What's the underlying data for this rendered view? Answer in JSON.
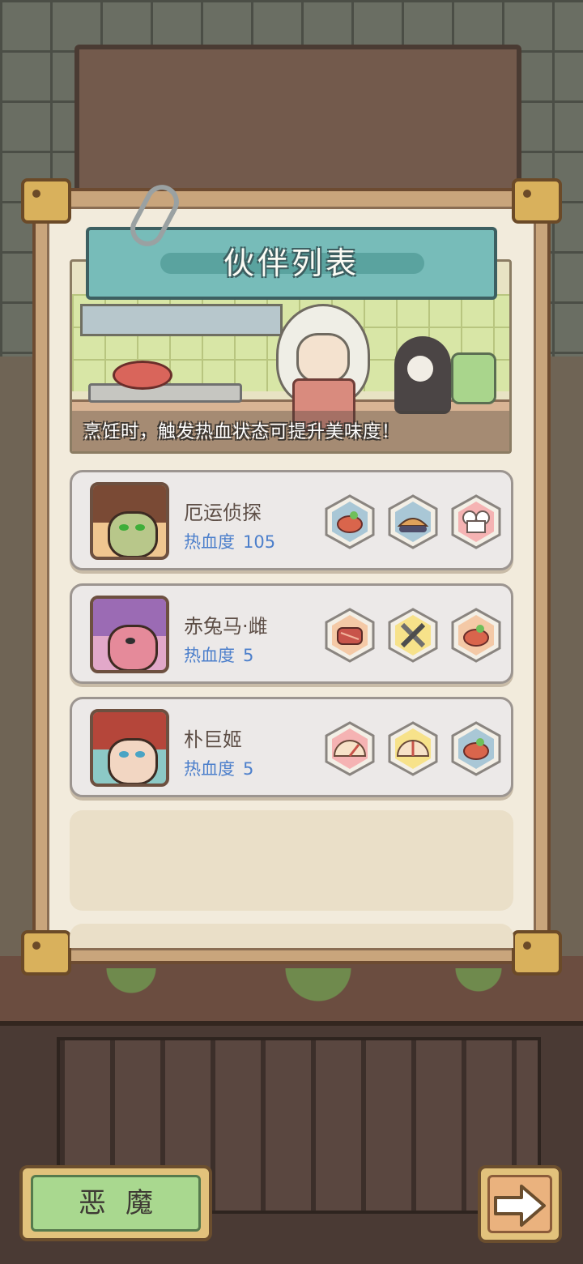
{
  "panel": {
    "title": "伙伴列表",
    "caption": "烹饪时，触发热血状态可提升美味度！"
  },
  "heat_label": "热血度",
  "companions": [
    {
      "name": "厄运侦探",
      "heat": "105",
      "skills": [
        "grilled-meat-skill-icon",
        "seafood-dish-skill-icon",
        "chef-hat-skill-icon"
      ]
    },
    {
      "name": "赤兔马·雌",
      "heat": "5",
      "skills": [
        "steak-skill-icon",
        "knife-spatula-skill-icon",
        "grilled-meat-skill-icon"
      ]
    },
    {
      "name": "朴巨姬",
      "heat": "5",
      "skills": [
        "gauge-skill-icon",
        "gauge-skill-icon",
        "grilled-meat-skill-icon"
      ]
    }
  ],
  "buttons": {
    "demon": "恶魔",
    "next_icon": "arrow-right-icon"
  },
  "colors": {
    "title_banner": "#77bcb9",
    "heat_text": "#4c7fcb",
    "demon_button": "#a9d88f",
    "panel_bg": "#f2ebdc"
  }
}
